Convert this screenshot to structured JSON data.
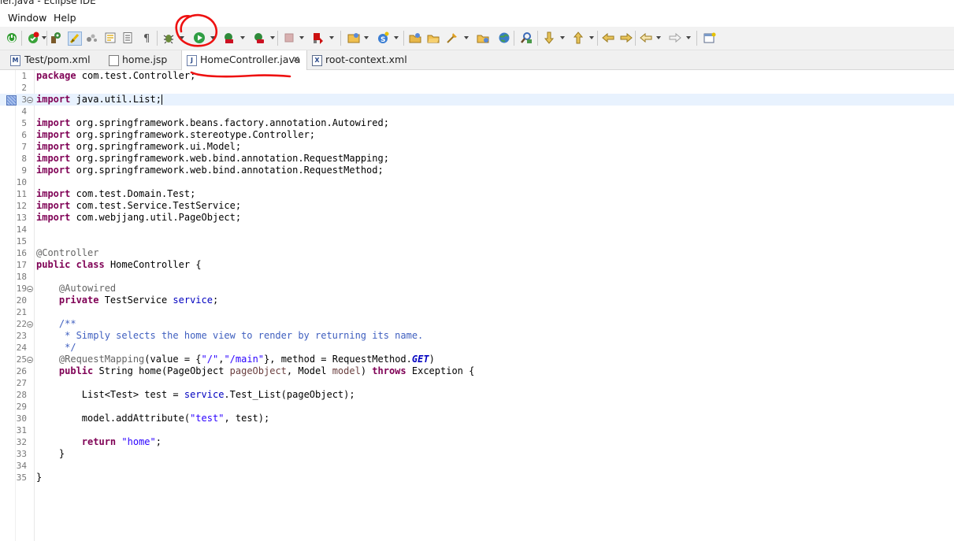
{
  "window": {
    "title": "ler.java - Eclipse IDE"
  },
  "menu": {
    "items": [
      "Window",
      "Help"
    ]
  },
  "toolbar": {
    "buttons": [
      "skip-all-breakpoints-icon",
      "new-icon",
      "build-icon",
      "toggle-mark-occurrences-icon",
      "toggle-block-selection-icon",
      "show-whitespace-icon",
      "debug-icon",
      "run-icon",
      "coverage-icon",
      "external-tools-icon",
      "stop-icon",
      "server-icon",
      "new-java-project-icon",
      "new-package-icon",
      "new-class-icon",
      "open-type-icon",
      "search-icon",
      "next-annotation-icon",
      "previous-annotation-icon",
      "last-edit-location-icon",
      "back-icon",
      "forward-icon",
      "open-perspective-icon"
    ]
  },
  "tabs": [
    {
      "label": "Test/pom.xml",
      "icon": "M"
    },
    {
      "label": "home.jsp",
      "icon": ""
    },
    {
      "label": "HomeController.java",
      "icon": "J",
      "active": true,
      "close": "✕"
    },
    {
      "label": "root-context.xml",
      "icon": "X"
    }
  ],
  "editor": {
    "current_line": 3,
    "lines": [
      {
        "n": "1",
        "text": "package com.test.Controller;"
      },
      {
        "n": "2",
        "text": ""
      },
      {
        "n": "3",
        "text": "import java.util.List;"
      },
      {
        "n": "4",
        "text": ""
      },
      {
        "n": "5",
        "text": "import org.springframework.beans.factory.annotation.Autowired;"
      },
      {
        "n": "6",
        "text": "import org.springframework.stereotype.Controller;"
      },
      {
        "n": "7",
        "text": "import org.springframework.ui.Model;"
      },
      {
        "n": "8",
        "text": "import org.springframework.web.bind.annotation.RequestMapping;"
      },
      {
        "n": "9",
        "text": "import org.springframework.web.bind.annotation.RequestMethod;"
      },
      {
        "n": "10",
        "text": ""
      },
      {
        "n": "11",
        "text": "import com.test.Domain.Test;"
      },
      {
        "n": "12",
        "text": "import com.test.Service.TestService;"
      },
      {
        "n": "13",
        "text": "import com.webjjang.util.PageObject;"
      },
      {
        "n": "14",
        "text": ""
      },
      {
        "n": "15",
        "text": ""
      },
      {
        "n": "16",
        "text": "@Controller"
      },
      {
        "n": "17",
        "text": "public class HomeController {"
      },
      {
        "n": "18",
        "text": ""
      },
      {
        "n": "19",
        "text": "    @Autowired"
      },
      {
        "n": "20",
        "text": "    private TestService service;"
      },
      {
        "n": "21",
        "text": ""
      },
      {
        "n": "22",
        "text": "    /**"
      },
      {
        "n": "23",
        "text": "     * Simply selects the home view to render by returning its name."
      },
      {
        "n": "24",
        "text": "     */"
      },
      {
        "n": "25",
        "text": "    @RequestMapping(value = {\"/\",\"/main\"}, method = RequestMethod.GET)"
      },
      {
        "n": "26",
        "text": "    public String home(PageObject pageObject, Model model) throws Exception {"
      },
      {
        "n": "27",
        "text": ""
      },
      {
        "n": "28",
        "text": "        List<Test> test = service.Test_List(pageObject);"
      },
      {
        "n": "29",
        "text": ""
      },
      {
        "n": "30",
        "text": "        model.addAttribute(\"test\", test);"
      },
      {
        "n": "31",
        "text": ""
      },
      {
        "n": "32",
        "text": "        return \"home\";"
      },
      {
        "n": "33",
        "text": "    }"
      },
      {
        "n": "34",
        "text": ""
      },
      {
        "n": "35",
        "text": "}"
      }
    ],
    "fold_lines": [
      "3",
      "19",
      "22",
      "25"
    ]
  },
  "colors": {
    "keyword": "#7f0055",
    "annotation": "#646464",
    "string": "#2a00ff",
    "javadoc": "#3f5fbf",
    "field": "#0000c0",
    "constant": "#0000c0",
    "annotation_circle": "#ee1111"
  }
}
